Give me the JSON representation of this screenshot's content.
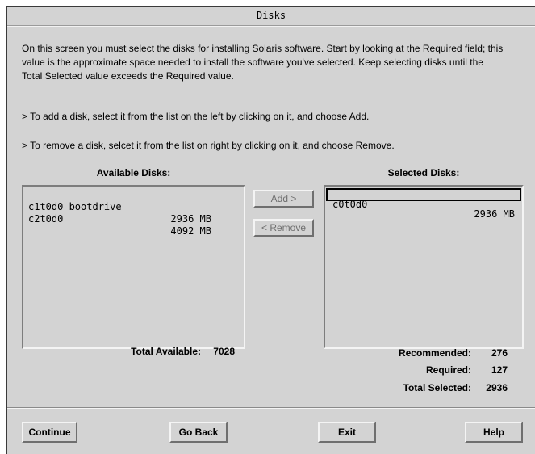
{
  "window": {
    "title": "Disks"
  },
  "intro": "On this screen you must select the disks for installing Solaris software. Start by looking at the Required field; this value is the approximate space needed to install the software you've selected. Keep selecting disks until the Total Selected value exceeds the Required value.",
  "hints": {
    "add": "> To add a disk, select it from the list on the left by clicking on it, and choose Add.",
    "remove": "> To remove a disk, selcet it from the list on right by clicking on it, and choose Remove."
  },
  "available": {
    "heading": "Available Disks:",
    "items": [
      {
        "name": "c1t0d0 bootdrive",
        "size": "2936 MB"
      },
      {
        "name": "c2t0d0",
        "size": "4092 MB"
      }
    ],
    "total_label": "Total Available:",
    "total_value": "7028"
  },
  "selected": {
    "heading": "Selected Disks:",
    "items": [
      {
        "name": "c0t0d0",
        "size": "2936 MB"
      }
    ]
  },
  "buttons": {
    "add": "Add >",
    "remove": "< Remove"
  },
  "stats": {
    "recommended_label": "Recommended:",
    "recommended_value": "276",
    "required_label": "Required:",
    "required_value": "127",
    "total_selected_label": "Total Selected:",
    "total_selected_value": "2936"
  },
  "footer": {
    "continue": "Continue",
    "go_back": "Go Back",
    "exit": "Exit",
    "help": "Help"
  }
}
